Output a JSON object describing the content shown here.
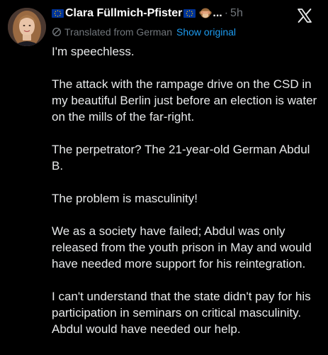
{
  "header": {
    "display_name": "Clara Füllmich-Pfister",
    "truncation": "...",
    "separator": "·",
    "timestamp": "5h"
  },
  "icons": {
    "leading_flag": "eu-flag-icon",
    "trailing_flag": "eu-flag-icon",
    "emoji": "see-no-evil-monkey-icon",
    "platform_logo": "x-logo-icon",
    "translate": "translate-icon"
  },
  "translation": {
    "label": "Translated from German",
    "link": "Show original"
  },
  "tweet": {
    "paragraphs": [
      "I'm speechless.",
      "The attack with the rampage drive on the CSD in my beautiful Berlin just before an election is water on the mills of the far-right.",
      "The perpetrator? The 21-year-old German Abdul B.",
      "The problem is masculinity!",
      "We as a society have failed; Abdul was only released from the youth prison in May and would have needed more support for his reintegration.",
      "I can't understand that the state didn't pay for his participation in seminars on critical masculinity. Abdul would have needed our help."
    ]
  },
  "colors": {
    "background": "#000000",
    "text": "#e7e9ea",
    "muted": "#71767b",
    "link": "#1d9bf0",
    "eu_blue": "#003399",
    "eu_gold": "#ffcc00"
  }
}
